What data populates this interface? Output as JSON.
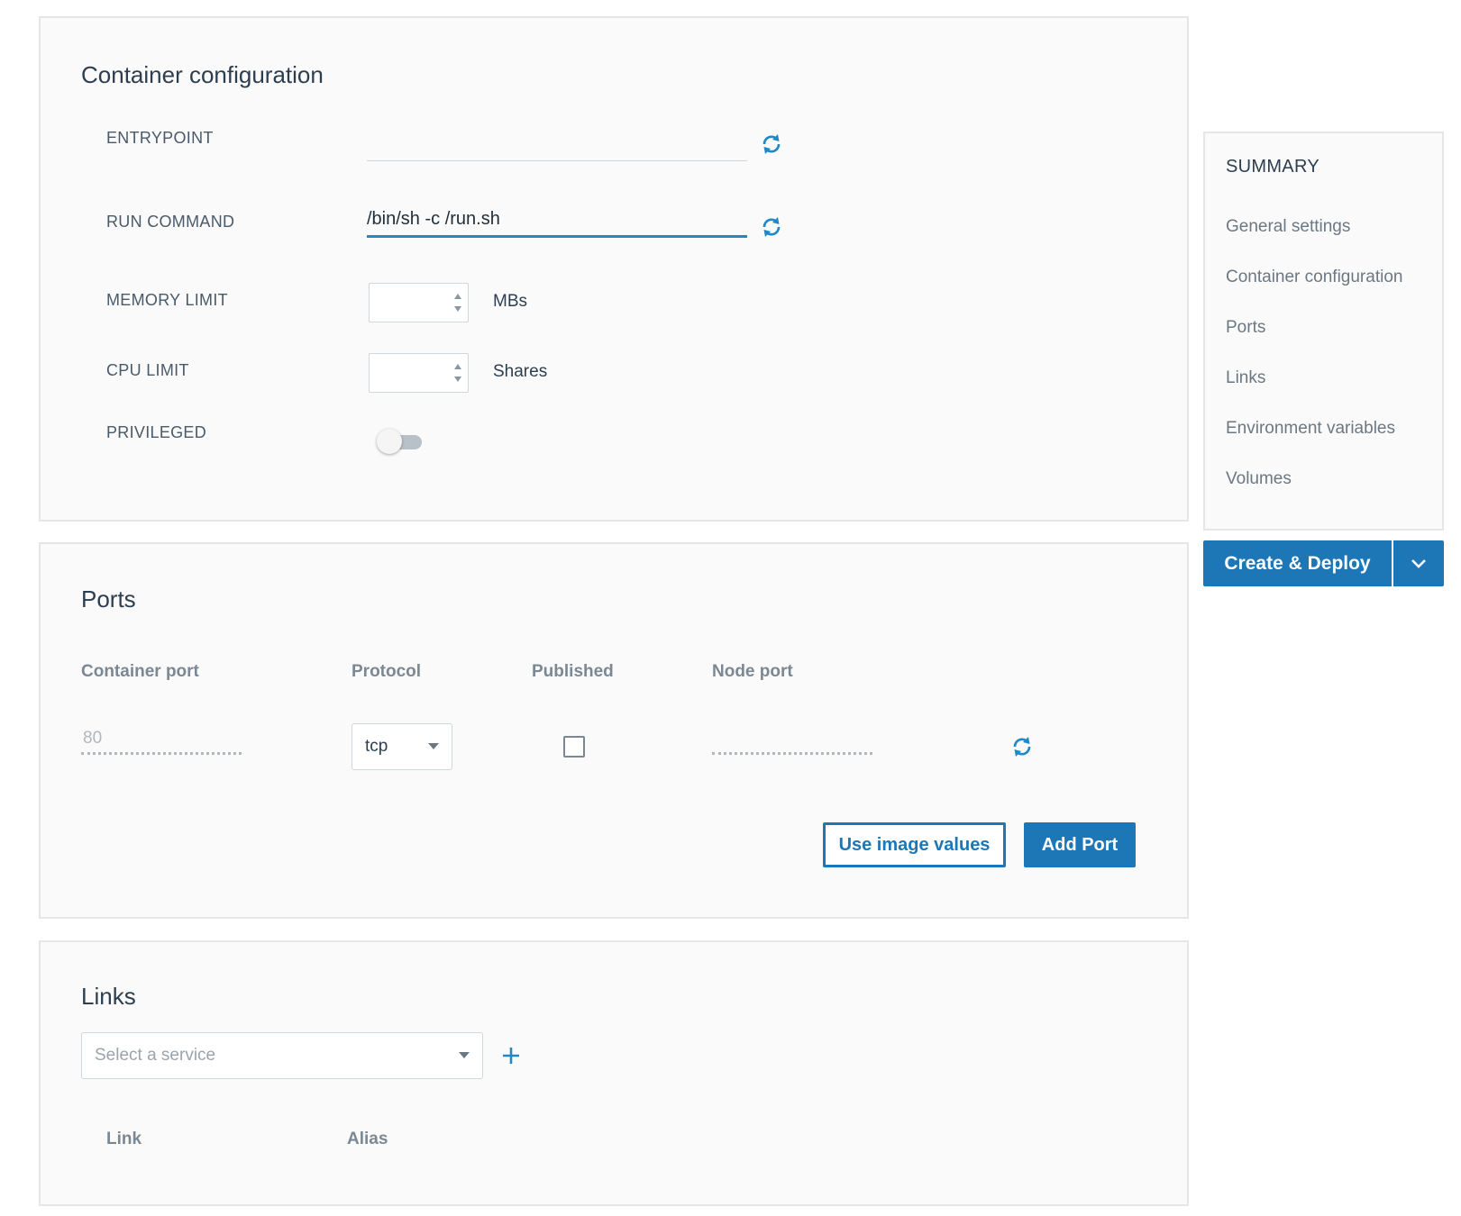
{
  "colors": {
    "accent": "#1d77b7",
    "panel_bg": "#fafafa",
    "border": "#e6e6e6",
    "muted_text": "#7b8893"
  },
  "container_config": {
    "title": "Container configuration",
    "entrypoint": {
      "label": "ENTRYPOINT",
      "value": "",
      "icon": "refresh-icon"
    },
    "run_command": {
      "label": "RUN COMMAND",
      "value": "/bin/sh -c /run.sh",
      "icon": "refresh-icon"
    },
    "memory_limit": {
      "label": "MEMORY LIMIT",
      "value": "",
      "unit": "MBs"
    },
    "cpu_limit": {
      "label": "CPU LIMIT",
      "value": "",
      "unit": "Shares"
    },
    "privileged": {
      "label": "PRIVILEGED",
      "enabled": false
    }
  },
  "ports": {
    "title": "Ports",
    "columns": [
      "Container port",
      "Protocol",
      "Published",
      "Node port"
    ],
    "row": {
      "container_port_placeholder": "80",
      "protocol": "tcp",
      "published": false,
      "node_port": "",
      "icon": "refresh-icon"
    },
    "use_image_values_label": "Use image values",
    "add_port_label": "Add Port"
  },
  "links": {
    "title": "Links",
    "select_placeholder": "Select a service",
    "add_icon": "plus-icon",
    "columns": [
      "Link",
      "Alias"
    ]
  },
  "summary": {
    "title": "SUMMARY",
    "items": [
      "General settings",
      "Container configuration",
      "Ports",
      "Links",
      "Environment variables",
      "Volumes"
    ]
  },
  "deploy": {
    "label": "Create & Deploy",
    "dropdown_icon": "chevron-down-icon"
  }
}
